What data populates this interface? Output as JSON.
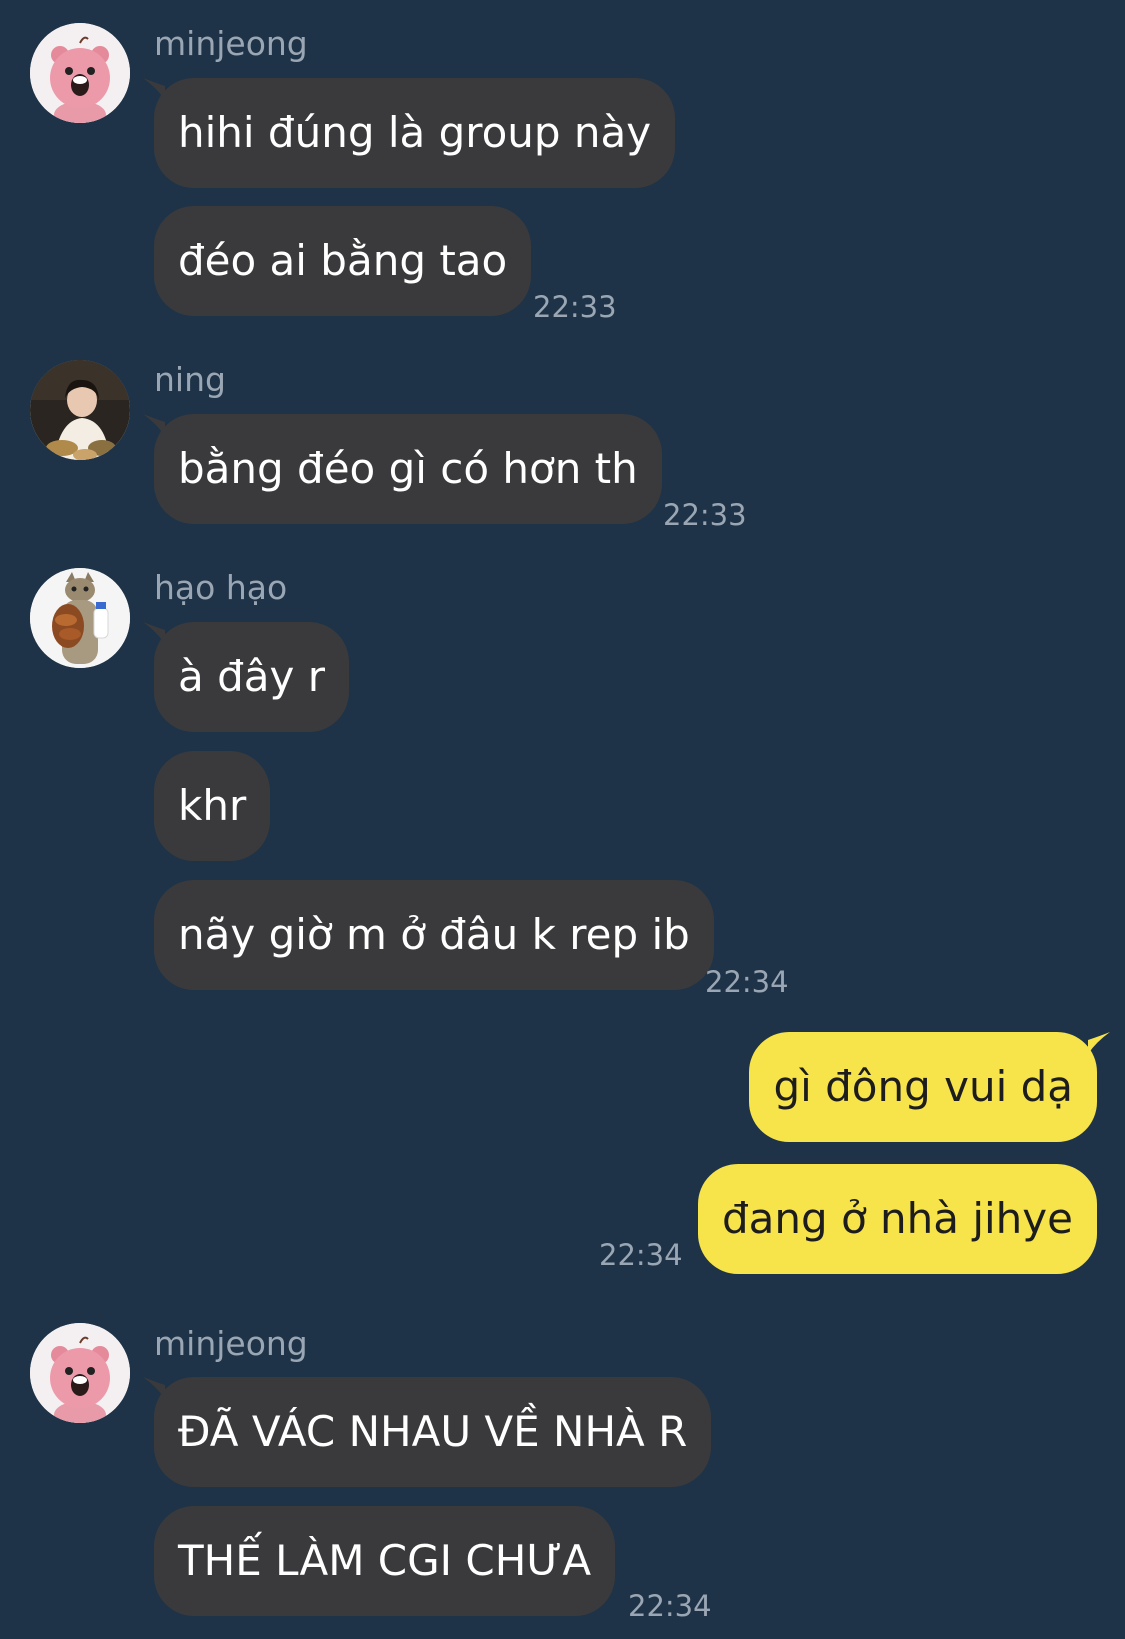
{
  "colors": {
    "background": "#1e3347",
    "incoming_bubble": "#3a3a3c",
    "outgoing_bubble": "#f7e34a",
    "meta_text": "#9aa6b3"
  },
  "groups": [
    {
      "sender": "minjeong",
      "avatar": "pink-beaver-avatar",
      "messages": [
        "hihi đúng là group này",
        "đéo ai bằng tao"
      ],
      "time": "22:33"
    },
    {
      "sender": "ning",
      "avatar": "photo-avatar",
      "messages": [
        "bằng đéo gì có hơn th"
      ],
      "time": "22:33"
    },
    {
      "sender": "hạo hạo",
      "avatar": "cat-avatar",
      "messages": [
        "à đây r",
        "khr",
        "nãy giờ m ở đâu k rep ib"
      ],
      "time": "22:34"
    },
    {
      "sender": "",
      "outgoing": true,
      "messages": [
        "gì đông vui dạ",
        "đang ở nhà jihye"
      ],
      "time": "22:34"
    },
    {
      "sender": "minjeong",
      "avatar": "pink-beaver-avatar",
      "messages": [
        "ĐÃ VÁC NHAU VỀ NHÀ R",
        "THẾ LÀM CGI CHƯA"
      ],
      "time": "22:34"
    }
  ]
}
